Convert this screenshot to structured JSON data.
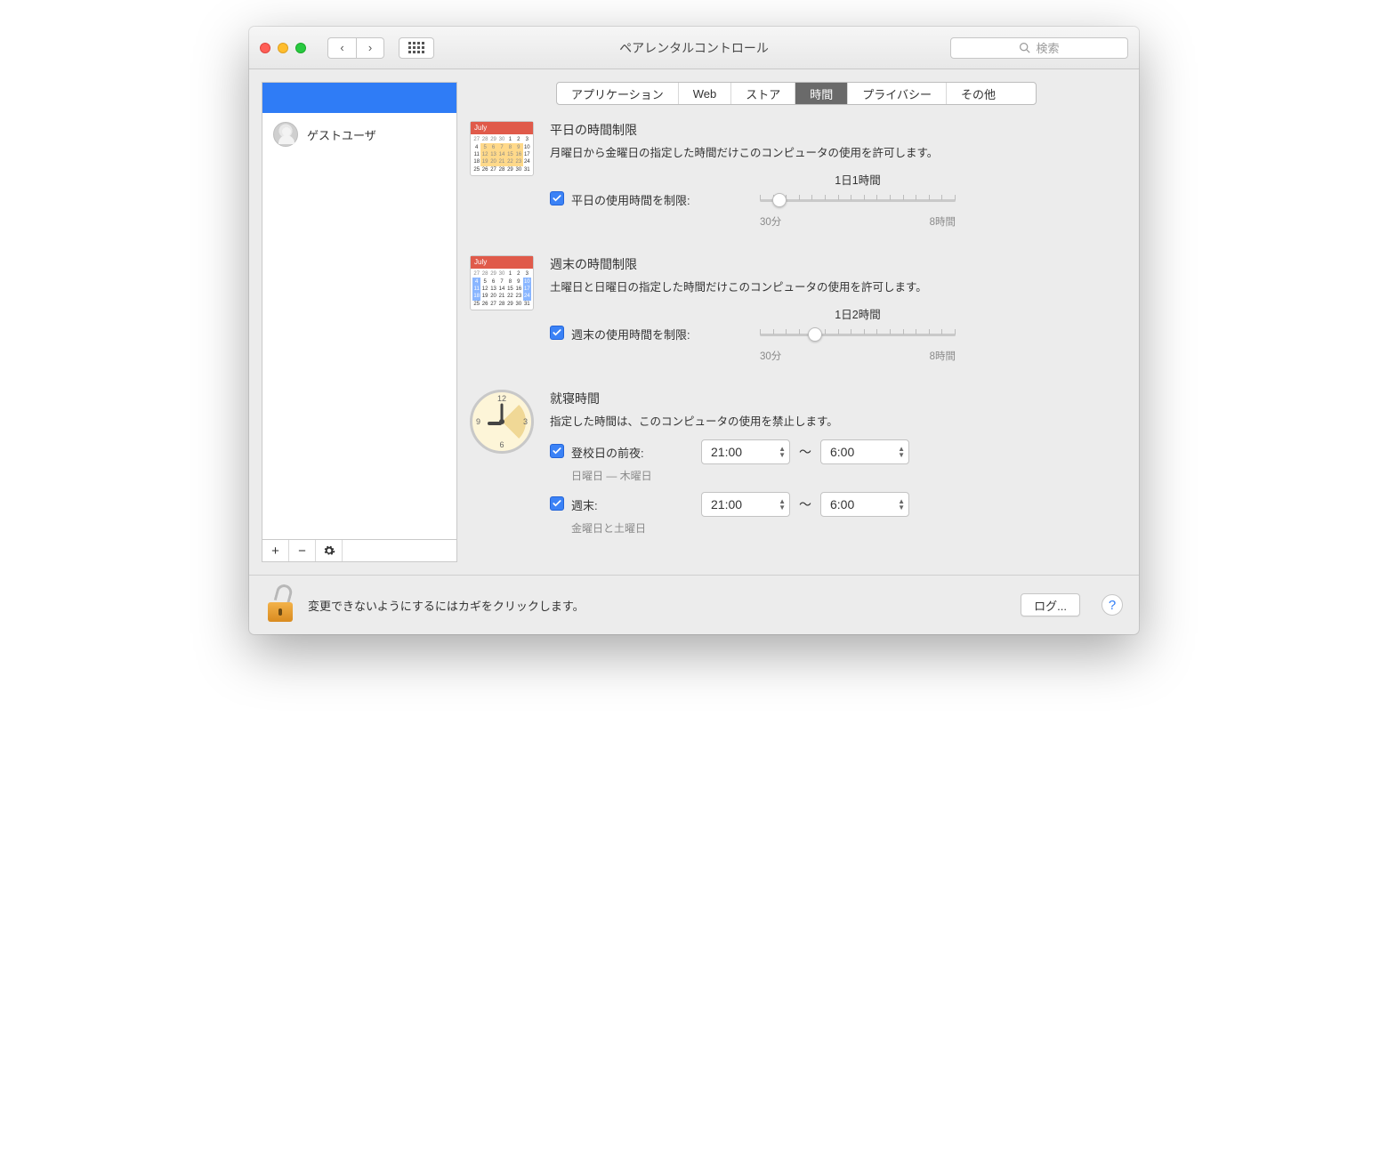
{
  "window": {
    "title": "ペアレンタルコントロール",
    "search_placeholder": "検索"
  },
  "tabs": {
    "apps": "アプリケーション",
    "web": "Web",
    "store": "ストア",
    "time": "時間",
    "privacy": "プライバシー",
    "other": "その他"
  },
  "sidebar": {
    "guest_user": "ゲストユーザ"
  },
  "calendar_icon": {
    "month": "July"
  },
  "weekday": {
    "title": "平日の時間制限",
    "desc": "月曜日から金曜日の指定した時間だけこのコンピュータの使用を許可します。",
    "check_label": "平日の使用時間を制限:",
    "slider_value": "1日1時間",
    "slider_min": "30分",
    "slider_max": "8時間",
    "thumb_percent": 10
  },
  "weekend": {
    "title": "週末の時間制限",
    "desc": "土曜日と日曜日の指定した時間だけこのコンピュータの使用を許可します。",
    "check_label": "週末の使用時間を制限:",
    "slider_value": "1日2時間",
    "slider_min": "30分",
    "slider_max": "8時間",
    "thumb_percent": 28
  },
  "bedtime": {
    "title": "就寝時間",
    "desc": "指定した時間は、このコンピュータの使用を禁止します。",
    "school": {
      "check_label": "登校日の前夜:",
      "sub": "日曜日 — 木曜日",
      "from": "21:00",
      "to": "6:00"
    },
    "weekend": {
      "check_label": "週末:",
      "sub": "金曜日と土曜日",
      "from": "21:00",
      "to": "6:00"
    },
    "separator": "〜"
  },
  "footer": {
    "lock_text": "変更できないようにするにはカギをクリックします。",
    "log_button": "ログ...",
    "help": "?"
  }
}
